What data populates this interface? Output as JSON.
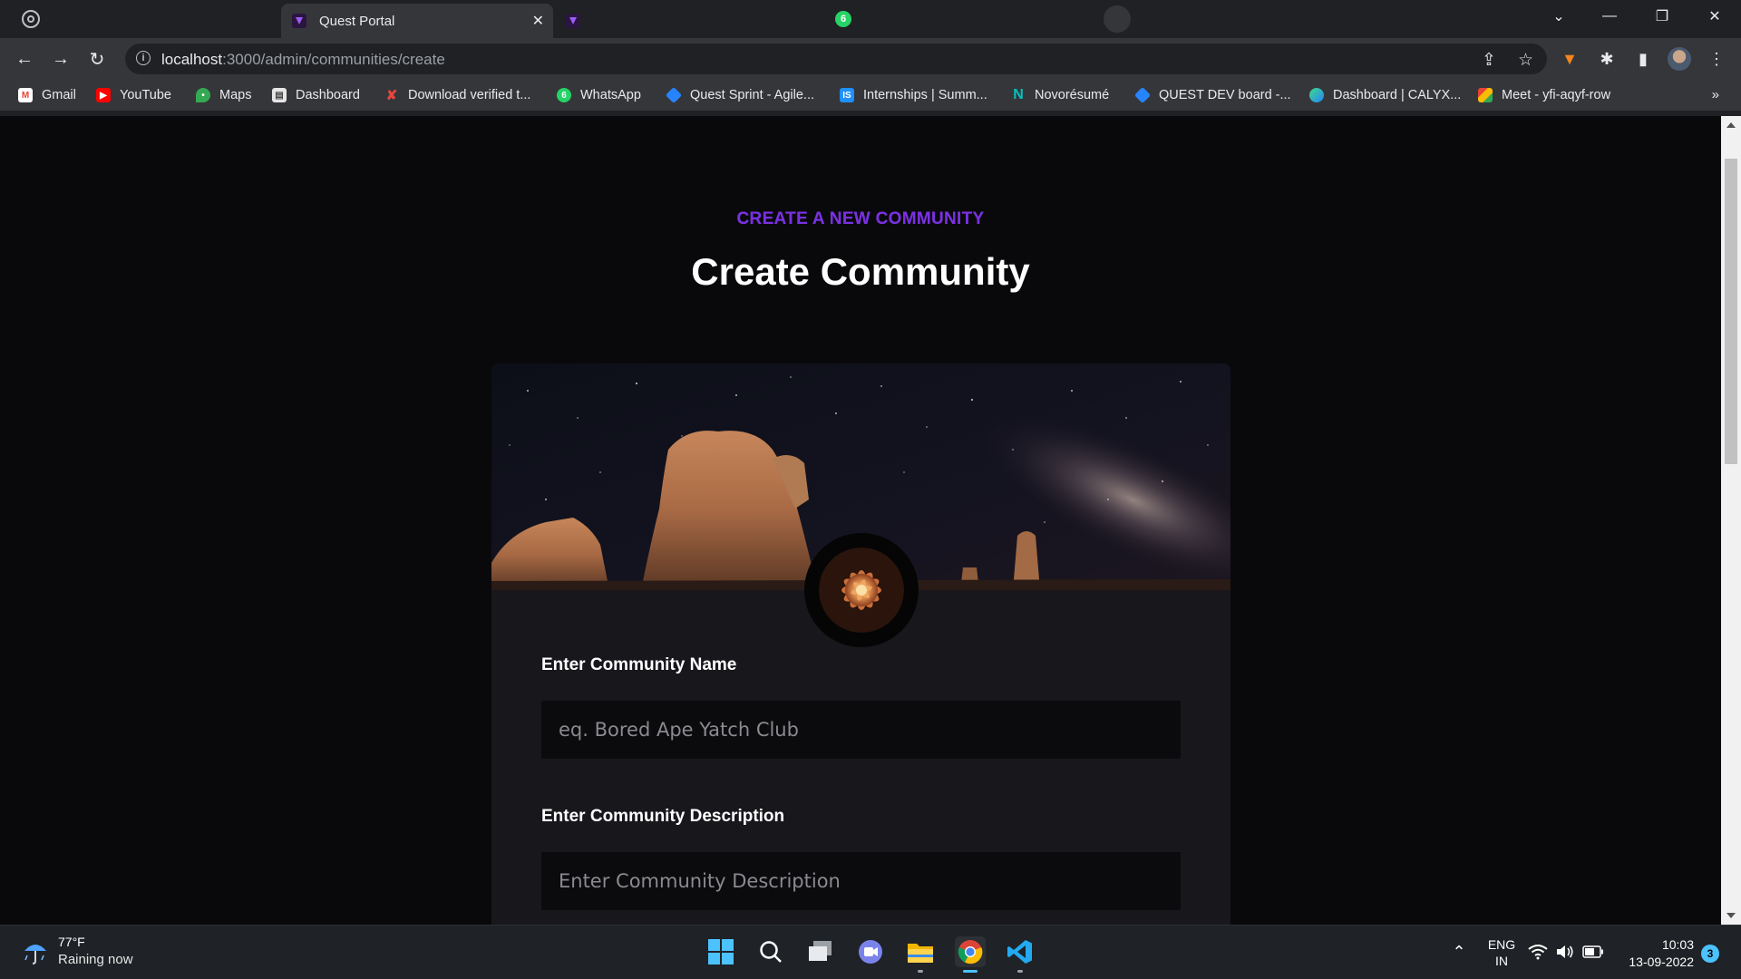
{
  "browser": {
    "tabs": [
      {
        "label": "Quest Portal",
        "active": true
      },
      {
        "label": "",
        "active": false
      },
      {
        "label": "",
        "active": false
      }
    ],
    "whatsapp_badge": "6",
    "url_host": "localhost",
    "url_path": ":3000/admin/communities/create",
    "bookmarks": [
      {
        "label": "Gmail",
        "icon": "gmail-icon",
        "color": "#ea4335"
      },
      {
        "label": "YouTube",
        "icon": "youtube-icon",
        "color": "#ff0000"
      },
      {
        "label": "Maps",
        "icon": "maps-icon",
        "color": "#34a853"
      },
      {
        "label": "Dashboard",
        "icon": "dashboard-icon",
        "color": "#d9d9d9"
      },
      {
        "label": "Download verified t...",
        "icon": "x-icon",
        "color": "#e8453c"
      },
      {
        "label": "WhatsApp",
        "icon": "whatsapp-icon",
        "color": "#25d366"
      },
      {
        "label": "Quest Sprint - Agile...",
        "icon": "jira-icon",
        "color": "#2684ff"
      },
      {
        "label": "Internships | Summ...",
        "icon": "internshala-icon",
        "color": "#1e90ff"
      },
      {
        "label": "Novorésumé",
        "icon": "novoresume-icon",
        "color": "#00b3b3"
      },
      {
        "label": "QUEST DEV board -...",
        "icon": "jira-icon",
        "color": "#2684ff"
      },
      {
        "label": "Dashboard | CALYX...",
        "icon": "calyx-icon",
        "color": "#3ddc84"
      },
      {
        "label": "Meet - yfi-aqyf-row",
        "icon": "meet-icon",
        "color": "#00897b"
      }
    ],
    "bookmarks_more": "»"
  },
  "page": {
    "eyebrow": "CREATE A NEW COMMUNITY",
    "title": "Create Community",
    "name_label": "Enter Community Name",
    "name_placeholder": "eq. Bored Ape Yatch Club",
    "description_label": "Enter Community Description",
    "description_placeholder": "Enter Community Description",
    "accent_color": "#6d28d9"
  },
  "taskbar": {
    "temperature": "77°F",
    "weather_text": "Raining now",
    "language_line1": "ENG",
    "language_line2": "IN",
    "time": "10:03",
    "date": "13-09-2022",
    "notifications": "3"
  }
}
